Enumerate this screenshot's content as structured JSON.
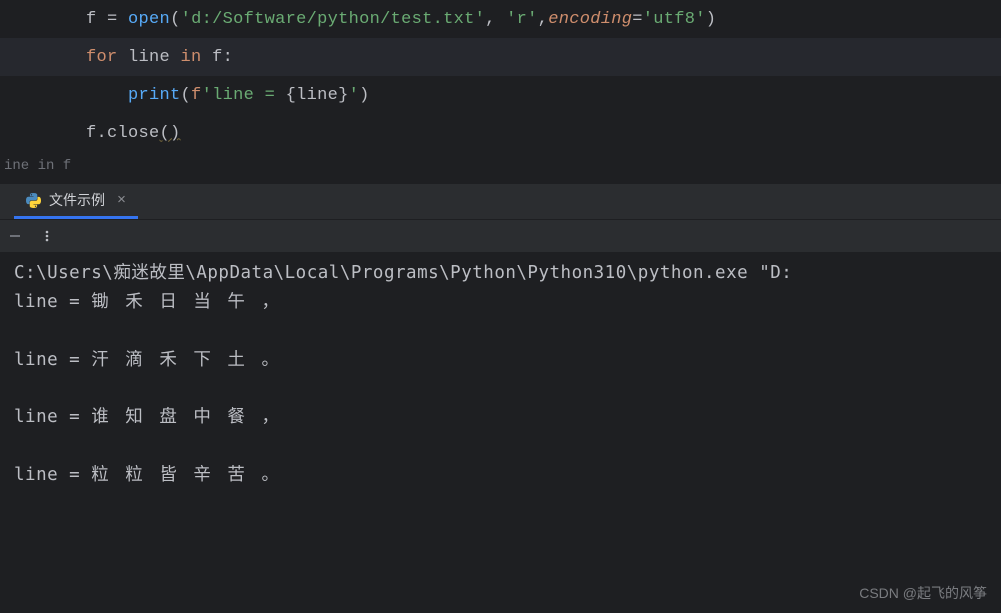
{
  "code": {
    "lines": [
      {
        "num": "",
        "tokens": [
          {
            "t": "var",
            "v": "f "
          },
          {
            "t": "op",
            "v": "= "
          },
          {
            "t": "fn",
            "v": "open"
          },
          {
            "t": "op",
            "v": "("
          },
          {
            "t": "str",
            "v": "'d:/Software/python/test.txt'"
          },
          {
            "t": "op",
            "v": ", "
          },
          {
            "t": "str",
            "v": "'r'"
          },
          {
            "t": "op",
            "v": ","
          },
          {
            "t": "param",
            "v": "encoding"
          },
          {
            "t": "op",
            "v": "="
          },
          {
            "t": "str",
            "v": "'utf8'"
          },
          {
            "t": "op",
            "v": ")"
          }
        ],
        "indent": "    ",
        "hl": false
      },
      {
        "num": "",
        "tokens": [
          {
            "t": "kw",
            "v": "for "
          },
          {
            "t": "var",
            "v": "line "
          },
          {
            "t": "kw",
            "v": "in "
          },
          {
            "t": "var",
            "v": "f:"
          }
        ],
        "indent": "    ",
        "hl": true
      },
      {
        "num": "",
        "tokens": [
          {
            "t": "fn",
            "v": "print"
          },
          {
            "t": "op",
            "v": "("
          },
          {
            "t": "kw",
            "v": "f"
          },
          {
            "t": "str",
            "v": "'line = "
          },
          {
            "t": "op",
            "v": "{"
          },
          {
            "t": "var",
            "v": "line"
          },
          {
            "t": "op",
            "v": "}"
          },
          {
            "t": "str",
            "v": "'"
          },
          {
            "t": "op",
            "v": ")"
          }
        ],
        "indent": "        ",
        "hl": false
      },
      {
        "num": "",
        "tokens": [
          {
            "t": "var",
            "v": "f.close"
          },
          {
            "t": "op",
            "v": "()"
          }
        ],
        "indent": "    ",
        "hl": false,
        "squiggle_last": true
      }
    ]
  },
  "breadcrumb": "ine in f",
  "tab": {
    "label": "文件示例"
  },
  "console": {
    "command": "C:\\Users\\痴迷故里\\AppData\\Local\\Programs\\Python\\Python310\\python.exe \"D:",
    "outputs": [
      {
        "prefix": "line = ",
        "text": "锄 禾 日 当 午 ，"
      },
      {
        "prefix": "line = ",
        "text": "汗 滴 禾 下 土 。"
      },
      {
        "prefix": "line = ",
        "text": "谁 知 盘 中 餐 ，"
      },
      {
        "prefix": "line = ",
        "text": "粒 粒 皆 辛 苦 。"
      }
    ]
  },
  "watermark": "CSDN @起飞的风筝"
}
